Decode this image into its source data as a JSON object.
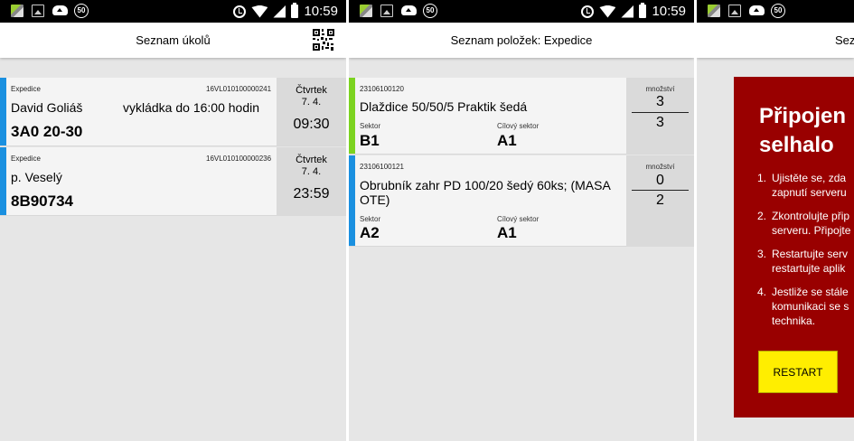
{
  "status_bar": {
    "time": "10:59",
    "badge": "50"
  },
  "screen1": {
    "title": "Seznam úkolů",
    "tasks": [
      {
        "category": "Expedice",
        "id": "16VL010100000241",
        "name": "David Goliáš",
        "note": "vykládka do 16:00 hodin",
        "code": "3A0 20-30",
        "day": "Čtvrtek",
        "date": "7. 4.",
        "time": "09:30"
      },
      {
        "category": "Expedice",
        "id": "16VL010100000236",
        "name": "p. Veselý",
        "note": "",
        "code": "8B90734",
        "day": "Čtvrtek",
        "date": "7. 4.",
        "time": "23:59"
      }
    ]
  },
  "screen2": {
    "title": "Seznam položek: Expedice",
    "items": [
      {
        "code": "23106100120",
        "name": "Dlaždice 50/50/5 Praktik šedá",
        "sector_label": "Sektor",
        "sector": "B1",
        "target_label": "Cílový sektor",
        "target": "A1",
        "qty_label": "množství",
        "qty_done": "3",
        "qty_total": "3",
        "color": "#7cd320"
      },
      {
        "code": "23106100121",
        "name_line1": "Obrubník zahr PD 100/20 šedý 60ks; (MASA",
        "name_line2": "OTE)",
        "sector_label": "Sektor",
        "sector": "A2",
        "target_label": "Cílový sektor",
        "target": "A1",
        "qty_label": "množství",
        "qty_done": "0",
        "qty_total": "2",
        "color": "#1a90e0"
      }
    ]
  },
  "screen3": {
    "title": "Sez",
    "error_title_1": "Připojen",
    "error_title_2": "selhalo",
    "steps": [
      {
        "n": "1.",
        "l1": "Ujistěte se, zda",
        "l2": "zapnutí serveru"
      },
      {
        "n": "2.",
        "l1": "Zkontrolujte přip",
        "l2": "serveru. Připojte"
      },
      {
        "n": "3.",
        "l1": "Restartujte serv",
        "l2": "restartujte aplik"
      },
      {
        "n": "4.",
        "l1": "Jestliže se stále",
        "l2": "komunikaci se s",
        "l3": "technika."
      }
    ],
    "restart_label": "RESTART"
  },
  "colors": {
    "accent_blue": "#1a90e0",
    "accent_green": "#7cd320",
    "error_red": "#990000",
    "restart_yellow": "#ffee00"
  }
}
